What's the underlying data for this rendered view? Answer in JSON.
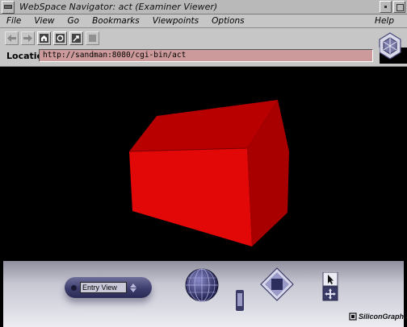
{
  "window": {
    "title": "WebSpace Navigator: act (Examiner Viewer)"
  },
  "menubar": {
    "file": "File",
    "view": "View",
    "go": "Go",
    "bookmarks": "Bookmarks",
    "viewpoints": "Viewpoints",
    "options": "Options",
    "help": "Help"
  },
  "toolbar": {
    "buttons": [
      {
        "icon": "back-arrow-icon",
        "enabled": false
      },
      {
        "icon": "forward-arrow-icon",
        "enabled": false
      },
      {
        "icon": "home-icon",
        "enabled": true
      },
      {
        "icon": "reload-icon",
        "enabled": true
      },
      {
        "icon": "open-icon",
        "enabled": true
      },
      {
        "icon": "stop-icon",
        "enabled": false
      }
    ]
  },
  "location": {
    "label": "Location:",
    "value": "http://sandman:8080/cgi-bin/act"
  },
  "scene": {
    "object": "red house",
    "color": "#e00000",
    "background": "#000000"
  },
  "dashboard": {
    "viewpoint_value": "Entry View",
    "brand": "SiliconGraphics"
  },
  "colors": {
    "chrome": "#c6c6c6",
    "location_field": "#cc9a9a",
    "dashboard_accent": "#3e3e6e"
  }
}
